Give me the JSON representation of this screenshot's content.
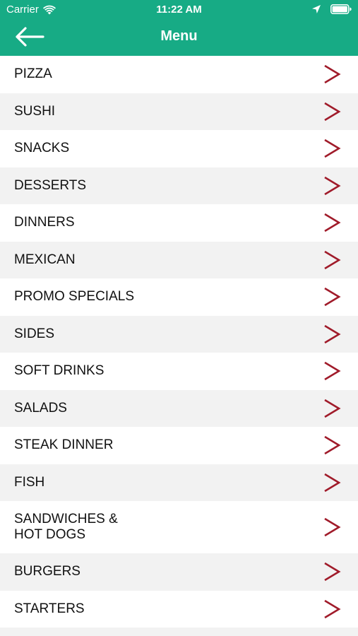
{
  "status_bar": {
    "carrier": "Carrier",
    "time": "11:22 AM"
  },
  "nav": {
    "title": "Menu",
    "back_icon": "arrow-left-icon"
  },
  "colors": {
    "header_bg": "#17ab85",
    "chevron": "#a01b2a"
  },
  "menu_items": [
    {
      "label": "PIZZA"
    },
    {
      "label": "SUSHI"
    },
    {
      "label": "SNACKS"
    },
    {
      "label": "DESSERTS"
    },
    {
      "label": "DINNERS"
    },
    {
      "label": "MEXICAN"
    },
    {
      "label": "PROMO SPECIALS"
    },
    {
      "label": "SIDES"
    },
    {
      "label": "SOFT DRINKS"
    },
    {
      "label": "SALADS"
    },
    {
      "label": "STEAK DINNER"
    },
    {
      "label": "FISH"
    },
    {
      "label": "SANDWICHES & HOT DOGS"
    },
    {
      "label": "BURGERS"
    },
    {
      "label": "STARTERS"
    }
  ]
}
